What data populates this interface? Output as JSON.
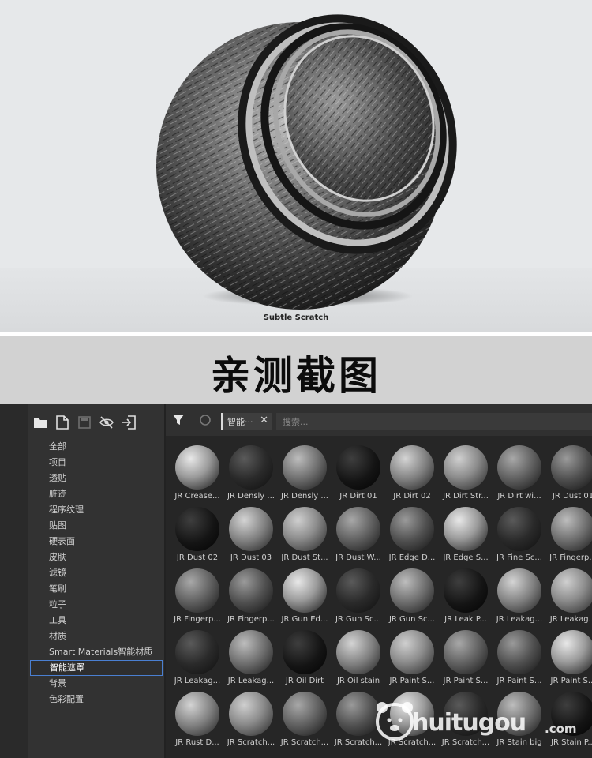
{
  "preview": {
    "caption": "Subtle Scratch"
  },
  "banner": {
    "title": "亲测截图"
  },
  "sidebar": {
    "toolbar_icons": [
      "folder-icon",
      "new-file-icon",
      "save-icon",
      "hide-icon",
      "import-icon"
    ],
    "categories": [
      {
        "label": "全部"
      },
      {
        "label": "项目"
      },
      {
        "label": "透贴"
      },
      {
        "label": "脏迹"
      },
      {
        "label": "程序纹理"
      },
      {
        "label": "贴图"
      },
      {
        "label": "硬表面"
      },
      {
        "label": "皮肤"
      },
      {
        "label": "滤镜"
      },
      {
        "label": "笔刷"
      },
      {
        "label": "粒子"
      },
      {
        "label": "工具"
      },
      {
        "label": "材质"
      },
      {
        "label": "Smart Materials智能材质"
      },
      {
        "label": "智能遮罩",
        "selected": true
      },
      {
        "label": "背景"
      },
      {
        "label": "色彩配置"
      }
    ]
  },
  "toolbar": {
    "filter_tag": "智能···",
    "close_glyph": "✕",
    "search_placeholder": "搜索..."
  },
  "assets": [
    [
      "JR Crease...",
      "JR Densly ...",
      "JR Densly ...",
      "JR Dirt 01",
      "JR Dirt 02",
      "JR Dirt Str...",
      "JR Dirt wi...",
      "JR Dust 01"
    ],
    [
      "JR Dust 02",
      "JR Dust 03",
      "JR Dust St...",
      "JR Dust W...",
      "JR Edge D...",
      "JR Edge S...",
      "JR Fine Sc...",
      "JR Fingerp..."
    ],
    [
      "JR Fingerp...",
      "JR Fingerp...",
      "JR Gun Ed...",
      "JR Gun Sc...",
      "JR Gun Sc...",
      "JR Leak P...",
      "JR Leakag...",
      "JR Leakag..."
    ],
    [
      "JR Leakag...",
      "JR Leakag...",
      "JR Oil Dirt",
      "JR Oil stain",
      "JR Paint S...",
      "JR Paint S...",
      "JR Paint S...",
      "JR Paint S..."
    ],
    [
      "JR Rust D...",
      "JR Scratch...",
      "JR Scratch...",
      "JR Scratch...",
      "JR Scratch...",
      "JR Scratch...",
      "JR Stain big",
      "JR Stain P..."
    ]
  ],
  "watermark": {
    "text": "huitugou",
    "suffix": ".com"
  }
}
